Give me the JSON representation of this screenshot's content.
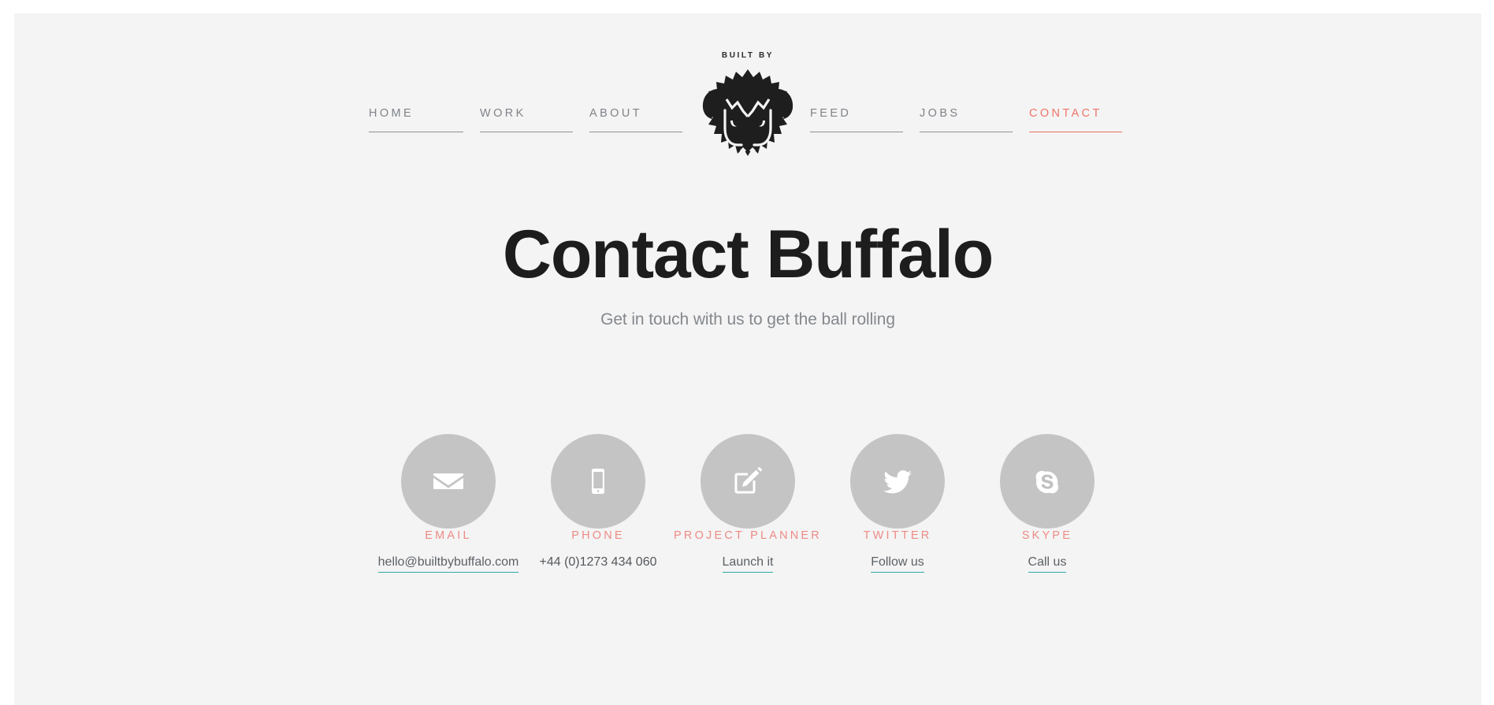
{
  "brand": {
    "kicker": "BUILT BY",
    "logo_icon": "buffalo-head-logo"
  },
  "nav": {
    "left_items": [
      {
        "label": "HOME",
        "active": false
      },
      {
        "label": "WORK",
        "active": false
      },
      {
        "label": "ABOUT",
        "active": false
      }
    ],
    "right_items": [
      {
        "label": "FEED",
        "active": false
      },
      {
        "label": "JOBS",
        "active": false
      },
      {
        "label": "CONTACT",
        "active": true
      }
    ]
  },
  "hero": {
    "title": "Contact Buffalo",
    "subtitle": "Get in touch with us to get the ball rolling"
  },
  "contacts": [
    {
      "icon": "envelope-icon",
      "label": "EMAIL",
      "action": "hello@builtbybuffalo.com",
      "underlined": true
    },
    {
      "icon": "mobile-phone-icon",
      "label": "PHONE",
      "action": "+44 (0)1273 434 060",
      "underlined": false
    },
    {
      "icon": "pencil-square-icon",
      "label": "PROJECT PLANNER",
      "action": "Launch it",
      "underlined": true
    },
    {
      "icon": "twitter-bird-icon",
      "label": "TWITTER",
      "action": "Follow us",
      "underlined": true
    },
    {
      "icon": "skype-icon",
      "label": "SKYPE",
      "action": "Call us",
      "underlined": true
    }
  ],
  "colors": {
    "page_background": "#f4f4f4",
    "frame_background": "#ffffff",
    "heading": "#1d1d1d",
    "muted_text": "#84888d",
    "accent_coral": "#ef6e64",
    "label_coral": "#ed8b85",
    "circle_gray": "#c4c4c4",
    "link_underline_teal": "#2fa8a8",
    "nav_rule": "#8e9196"
  }
}
